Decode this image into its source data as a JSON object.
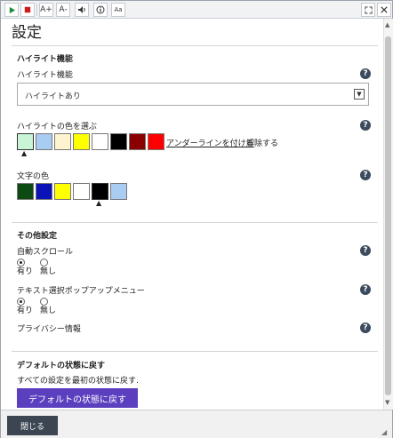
{
  "toolbar": {
    "play_icon": "play-icon",
    "stop_icon": "stop-icon",
    "font_up_label": "A+",
    "font_down_label": "A-",
    "volume_icon": "volume-icon",
    "info_icon": "info-icon",
    "ad_label": "Aa",
    "expand_icon": "expand-icon",
    "colors": {
      "play": "#1e8c3a",
      "stop": "#d11a1a"
    }
  },
  "page": {
    "title": "設定"
  },
  "highlight": {
    "section_heading": "ハイライト機能",
    "label": "ハイライト機能",
    "select_value": "ハイライトあり",
    "color_label": "ハイライトの色を選ぶ",
    "swatches": [
      "#c9f5d6",
      "#a9ccf2",
      "#fff4cf",
      "#ffff00",
      "#ffffff",
      "#000000",
      "#8b0000",
      "#ff0000"
    ],
    "underline_link": "アンダーラインを付ける",
    "remove_label": "解除する"
  },
  "text_color": {
    "label": "文字の色",
    "swatches": [
      "#0c4a12",
      "#0a12b8",
      "#ffff00",
      "#ffffff",
      "#000000",
      "#a9ccf2"
    ]
  },
  "other": {
    "section_heading": "その他設定",
    "autoscroll_label": "自動スクロール",
    "popup_label": "テキスト選択ポップアップメニュー",
    "yes": "有り",
    "no": "無し",
    "privacy_label": "プライバシー情報"
  },
  "reset": {
    "section_heading": "デフォルトの状態に戻す",
    "description": "すべての設定を最初の状態に戻す.",
    "button_label": "デフォルトの状態に戻す",
    "button_color": "#5b3fbf"
  },
  "footer": {
    "close_label": "閉じる"
  },
  "help_glyph": "?"
}
